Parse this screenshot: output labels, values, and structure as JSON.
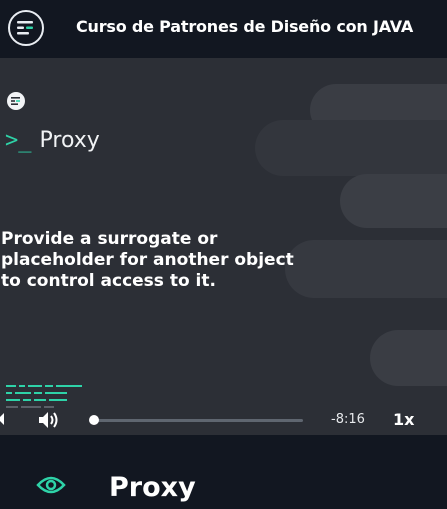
{
  "header": {
    "title": "Curso de Patrones de Diseño con JAVA",
    "menu_icon": "menu-icon"
  },
  "video": {
    "slide_heading": "Proxy",
    "slide_prompt": ">_",
    "slide_description": "Provide a surrogate or placeholder for another object to control access to it.",
    "controls": {
      "time_remaining": "-8:16",
      "speed": "1x",
      "progress": 0.02
    }
  },
  "lesson": {
    "title": "Proxy",
    "icon": "eye-icon"
  },
  "colors": {
    "accent": "#2ed3a8",
    "background": "#121721",
    "video_background": "#2c2f36"
  }
}
